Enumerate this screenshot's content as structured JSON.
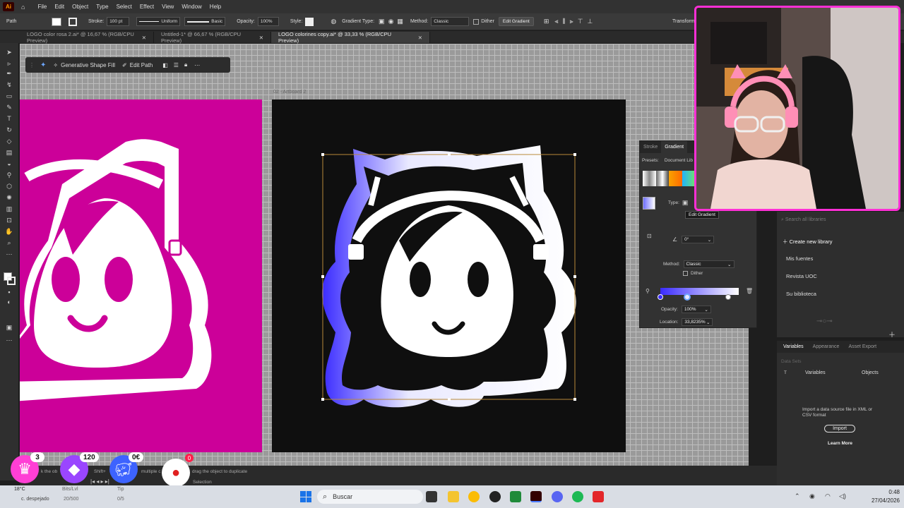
{
  "menubar": {
    "items": [
      "File",
      "Edit",
      "Object",
      "Type",
      "Select",
      "Effect",
      "View",
      "Window",
      "Help"
    ]
  },
  "controlbar": {
    "selection_type": "Path",
    "stroke_label": "Stroke:",
    "stroke_value": "100 pt",
    "profile_value": "Uniform",
    "brush_value": "Basic",
    "opacity_label": "Opacity:",
    "opacity_value": "100%",
    "style_label": "Style:",
    "gradient_type_label": "Gradient Type:",
    "method_label": "Method:",
    "method_value": "Classic",
    "dither_label": "Dither",
    "edit_gradient_label": "Edit Gradient",
    "transform_label": "Transform"
  },
  "tabs": [
    {
      "label": "LOGO color rosa 2.ai* @ 16,67 % (RGB/CPU Preview)"
    },
    {
      "label": "Untitled-1* @ 66,67 % (RGB/CPU Preview)"
    },
    {
      "label": "LOGO colorines copy.ai* @ 33,33 % (RGB/CPU Preview)"
    }
  ],
  "contextbar": {
    "generative_label": "Generative Shape Fill",
    "edit_path_label": "Edit Path"
  },
  "artboard_label": "02 - Artboard 2",
  "gradient_panel": {
    "tab_stroke": "Stroke",
    "tab_gradient": "Gradient",
    "presets_label": "Presets:",
    "presets_value": "Document Lib",
    "type_label": "Type:",
    "tooltip": "Edit Gradient",
    "angle_value": "0°",
    "method_label": "Method:",
    "method_value": "Classic",
    "dither_label": "Dither",
    "opacity_label": "Opacity:",
    "opacity_value": "100%",
    "location_label": "Location:",
    "location_value": "33,8235%",
    "gradient_start": "#3a2bff",
    "gradient_end": "#ffffff"
  },
  "libraries_panel": {
    "search_placeholder": "Search all libraries",
    "create_label": "Create new library",
    "items": [
      "Mis fuentes",
      "Revista UOC",
      "Su biblioteca"
    ]
  },
  "variables_panel": {
    "tabs": [
      "Variables",
      "Appearance",
      "Asset Export"
    ],
    "data_sets_label": "Data Sets",
    "col_variables": "Variables",
    "col_objects": "Objects",
    "import_text": "Import a data source file in XML or CSV format",
    "import_button": "Import",
    "learn_more": "Learn More"
  },
  "statusbar": {
    "hint_left": "k the ob",
    "hint_mid": "Shift+",
    "hint_multi": "multiple c",
    "hint_drag": "drag the object to duplicate",
    "selection_label": "Selection"
  },
  "stream_overlay": {
    "crown_count": "3",
    "gem_count": "120",
    "piggy_value": "0€",
    "apple_count": "0",
    "weather_temp": "18°C",
    "weather_desc": "c. despejado",
    "goal_label": "Bits/Lvl",
    "goal_value": "20/500",
    "sub_label": "Tip",
    "sub_value": "0/5"
  },
  "taskbar": {
    "search_placeholder": "Buscar",
    "time": "0:48",
    "date": "27/04/2026"
  },
  "colors": {
    "magenta": "#cc0099",
    "webcam_border": "#ff2fd6",
    "canvas_dark": "#0f0f0f"
  }
}
